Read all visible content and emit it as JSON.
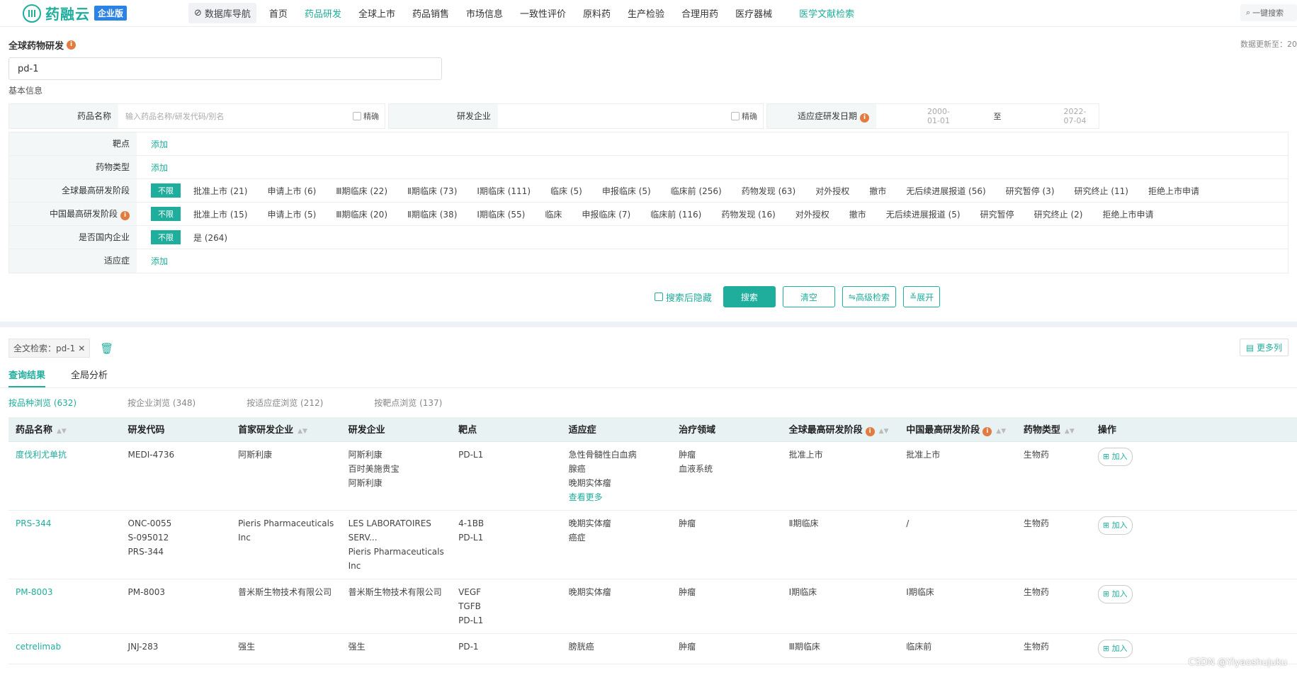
{
  "header": {
    "logo_text": "药融云",
    "logo_badge": "企业版",
    "db_nav": "数据库导航",
    "nav": [
      "首页",
      "药品研发",
      "全球上市",
      "药品销售",
      "市场信息",
      "一致性评价",
      "原料药",
      "生产检验",
      "合理用药",
      "医疗器械"
    ],
    "nav_special": "医学文献检索",
    "quick_search": "一键搜索"
  },
  "section": {
    "title": "全球药物研发",
    "update": "数据更新至：20",
    "keyword": "pd-1",
    "basic_info": "基本信息"
  },
  "top_filters": {
    "drug_label": "药品名称",
    "drug_placeholder": "输入药品名称/研发代码/别名",
    "exact": "精确",
    "company_label": "研发企业",
    "date_label": "适应症研发日期",
    "date_from": "2000-01-01",
    "date_sep": "至",
    "date_to": "2022-07-04"
  },
  "filters": {
    "target_label": "靶点",
    "add": "添加",
    "type_label": "药物类型",
    "global_label": "全球最高研发阶段",
    "china_label": "中国最高研发阶段",
    "domestic_label": "是否国内企业",
    "indication_label": "适应症",
    "unlimited": "不限",
    "global_opts": [
      "批准上市 (21)",
      "申请上市 (6)",
      "Ⅲ期临床 (22)",
      "Ⅱ期临床 (73)",
      "Ⅰ期临床 (111)",
      "临床 (5)",
      "申报临床 (5)",
      "临床前 (256)",
      "药物发现 (63)",
      "对外授权",
      "撤市",
      "无后续进展报道 (56)",
      "研究暂停 (3)",
      "研究终止 (11)",
      "拒绝上市申请"
    ],
    "china_opts": [
      "批准上市 (15)",
      "申请上市 (5)",
      "Ⅲ期临床 (20)",
      "Ⅱ期临床 (38)",
      "Ⅰ期临床 (55)",
      "临床",
      "申报临床 (7)",
      "临床前 (116)",
      "药物发现 (16)",
      "对外授权",
      "撤市",
      "无后续进展报道 (5)",
      "研究暂停",
      "研究终止 (2)",
      "拒绝上市申请"
    ],
    "domestic_opts": [
      "是 (264)"
    ]
  },
  "actions": {
    "hide_after": "搜索后隐藏",
    "search": "搜索",
    "clear": "清空",
    "advanced": "高级检索",
    "expand": "展开"
  },
  "results": {
    "chip": "全文检索：pd-1",
    "more_cols": "更多列",
    "tabs": [
      "查询结果",
      "全局分析"
    ],
    "browse": [
      "按品种浏览 (632)",
      "按企业浏览 (348)",
      "按适应症浏览 (212)",
      "按靶点浏览 (137)"
    ],
    "columns": [
      "药品名称",
      "研发代码",
      "首家研发企业",
      "研发企业",
      "靶点",
      "适应症",
      "治疗领域",
      "全球最高研发阶段",
      "中国最高研发阶段",
      "药物类型",
      "操作"
    ],
    "add_label": "加入",
    "see_more": "查看更多",
    "rows": [
      {
        "name": "度伐利尤单抗",
        "code": [
          "MEDI-4736"
        ],
        "first": "阿斯利康",
        "companies": [
          "阿斯利康",
          "百时美施贵宝",
          "阿斯利康"
        ],
        "targets": [
          "PD-L1"
        ],
        "indications": [
          "急性骨髓性白血病",
          "腺癌",
          "晚期实体瘤"
        ],
        "more": true,
        "areas": [
          "肿瘤",
          "血液系统"
        ],
        "global": "批准上市",
        "china": "批准上市",
        "type": "生物药"
      },
      {
        "name": "PRS-344",
        "code": [
          "ONC-0055",
          "S-095012",
          "PRS-344"
        ],
        "first": "Pieris Pharmaceuticals Inc",
        "companies": [
          "LES LABORATOIRES SERV...",
          "Pieris Pharmaceuticals Inc"
        ],
        "targets": [
          "4-1BB",
          "PD-L1"
        ],
        "indications": [
          "晚期实体瘤",
          "癌症"
        ],
        "more": false,
        "areas": [
          "肿瘤"
        ],
        "global": "Ⅱ期临床",
        "china": "/",
        "type": "生物药"
      },
      {
        "name": "PM-8003",
        "code": [
          "PM-8003"
        ],
        "first": "普米斯生物技术有限公司",
        "companies": [
          "普米斯生物技术有限公司"
        ],
        "targets": [
          "VEGF",
          "TGFB",
          "PD-L1"
        ],
        "indications": [
          "晚期实体瘤"
        ],
        "more": false,
        "areas": [
          "肿瘤"
        ],
        "global": "Ⅰ期临床",
        "china": "Ⅰ期临床",
        "type": "生物药"
      },
      {
        "name": "cetrelimab",
        "code": [
          "JNJ-283"
        ],
        "first": "强生",
        "companies": [
          "强生"
        ],
        "targets": [
          "PD-1"
        ],
        "indications": [
          "膀胱癌"
        ],
        "more": false,
        "areas": [
          "肿瘤"
        ],
        "global": "Ⅲ期临床",
        "china": "临床前",
        "type": "生物药"
      }
    ]
  },
  "watermark": "CSDN @Yiyaoshujuku"
}
